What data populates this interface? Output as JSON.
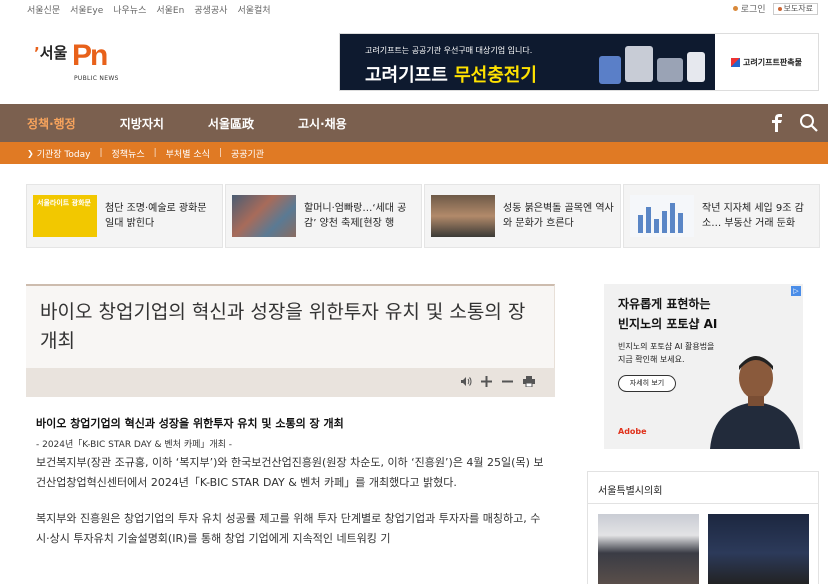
{
  "topbar": {
    "sites": [
      "서울신문",
      "서울Eye",
      "나우뉴스",
      "서울En",
      "공생공사",
      "서울컬처"
    ],
    "login": "로그인",
    "press_release": "보도자료"
  },
  "logo": {
    "seoul": "서울",
    "pn": "Pn",
    "sub": "PUBLIC NEWS"
  },
  "banner": {
    "small": "고려기프트는 공공기관 우선구매 대상기업 입니다.",
    "big_prefix": "고려기프트",
    "big_highlight": "무선충전기",
    "brand": "고려기프트판촉물"
  },
  "mainnav": {
    "items": [
      "정책·행정",
      "지방자치",
      "서울區政",
      "고시·채용"
    ]
  },
  "subnav": {
    "items": [
      "기관장 Today",
      "정책뉴스",
      "부처별 소식",
      "공공기관"
    ]
  },
  "news_strip": [
    {
      "thumb_label": "서울라이트 광화문",
      "title": "첨단 조명·예술로 광화문 일대 밝힌다"
    },
    {
      "title": "할머니·엄빠랑…‘세대 공감’ 양천 축제[현장 행"
    },
    {
      "title": "성동 붉은벽돌 골목엔 역사와 문화가 흐른다"
    },
    {
      "title": "작년 지자체 세입 9조 감소… 부동산 거래 둔화"
    }
  ],
  "article": {
    "title": "바이오 창업기업의 혁신과 성장을 위한투자 유치 및 소통의 장 개최",
    "lead": "바이오 창업기업의 혁신과 성장을 위한투자 유치 및 소통의 장 개최",
    "subhead": "- 2024년「K-BIC STAR DAY & 벤처 카페」개최 -",
    "para1": " 보건복지부(장관 조규홍, 이하 ‘복지부’)와 한국보건산업진흥원(원장 차순도, 이하 ‘진흥원’)은 4월 25일(목) 보건산업창업혁신센터에서 2024년「K-BIC STAR DAY & 벤처 카페」를 개최했다고 밝혔다.",
    "para2": " 복지부와 진흥원은 창업기업의 투자 유치 성공률 제고를 위해 투자 단계별로 창업기업과 투자자를 매칭하고, 수시·상시 투자유치 기술설명회(IR)를 통해 창업 기업에게 지속적인 네트워킹 기"
  },
  "side_ad": {
    "title_line1": "자유롭게 표현하는",
    "title_line2": "빈지노의 포토샵 AI",
    "desc_line1": "빈지노의 포토샵 AI 활용법을",
    "desc_line2": "지금 확인해 보세요.",
    "button": "자세히 보기",
    "brand": "Adobe"
  },
  "council": {
    "title": "서울특별시의회"
  },
  "colors": {
    "nav_brown": "#7b604f",
    "sub_orange": "#e07a24",
    "active_orange": "#f7a35c",
    "logo_orange": "#e8611a"
  }
}
